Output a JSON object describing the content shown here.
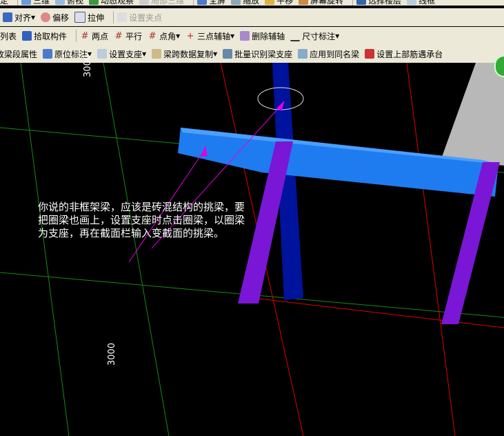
{
  "toolbar_top": [
    "定",
    "三维",
    "俯视",
    "动态观察",
    "局部三维",
    "全屏",
    "缩放",
    "平移",
    "屏幕旋转",
    "选择楼层",
    "线框"
  ],
  "toolbar_edit": [
    "对齐",
    "偏移",
    "拉伸",
    "设置夹点"
  ],
  "toolbar_axis": [
    "列表",
    "拾取构件",
    "两点",
    "平行",
    "点角",
    "三点辅轴",
    "删除辅轴",
    "尺寸标注"
  ],
  "toolbar_beam": [
    "改梁段属性",
    "原位标注",
    "设置支座",
    "梁跨数据复制",
    "批量识别梁支座",
    "应用到同名梁",
    "设置上部筋遇承台"
  ],
  "canvas": {
    "dim_top": "3000",
    "dim_bottom": "3000",
    "note": "你说的非框架梁，应该是砖混结构的挑梁，要把圈梁也画上，设置支座时点击圈梁，以圈梁为支座，再在截面栏输入变截面的挑梁。"
  },
  "colors": {
    "beam": "#1e7cf0",
    "column": "#00139c",
    "support": "#7a16d6",
    "grid_green": "#1a8a1a",
    "grid_red": "#e00000",
    "arrow": "#e000e0"
  }
}
